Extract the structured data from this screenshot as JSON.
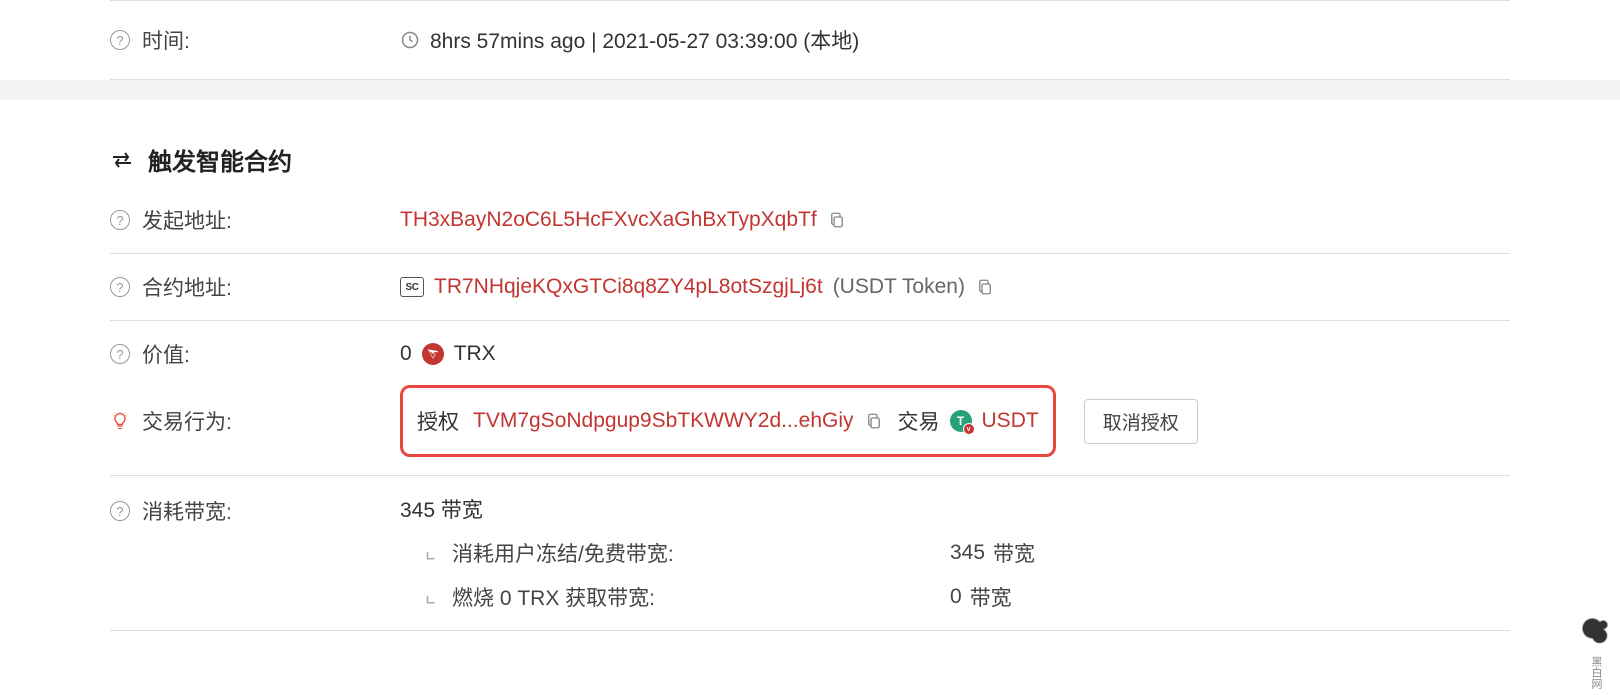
{
  "time": {
    "label": "时间:",
    "value": "8hrs 57mins ago | 2021-05-27 03:39:00 (本地)"
  },
  "section": {
    "title": "触发智能合约"
  },
  "from": {
    "label": "发起地址:",
    "address": "TH3xBayN2oC6L5HcFXvcXaGhBxTypXqbTf"
  },
  "contract": {
    "label": "合约地址:",
    "sc_badge": "SC",
    "address": "TR7NHqjeKQxGTCi8q8ZY4pL8otSzgjLj6t",
    "note": "(USDT Token)"
  },
  "value": {
    "label": "价值:",
    "amount": "0",
    "currency": "TRX"
  },
  "action": {
    "label": "交易行为:",
    "authorize_label": "授权",
    "spender_address": "TVM7gSoNdpgup9SbTKWWY2d...ehGiy",
    "trade_label": "交易",
    "token": "USDT",
    "cancel_button": "取消授权"
  },
  "bandwidth": {
    "label": "消耗带宽:",
    "main_value": "345",
    "main_unit": "带宽",
    "sub1_label": "消耗用户冻结/免费带宽:",
    "sub1_value": "345",
    "sub1_unit": "带宽",
    "sub2_label": "燃烧 0 TRX 获取带宽:",
    "sub2_value": "0",
    "sub2_unit": "带宽"
  },
  "watermark": "黑白网"
}
